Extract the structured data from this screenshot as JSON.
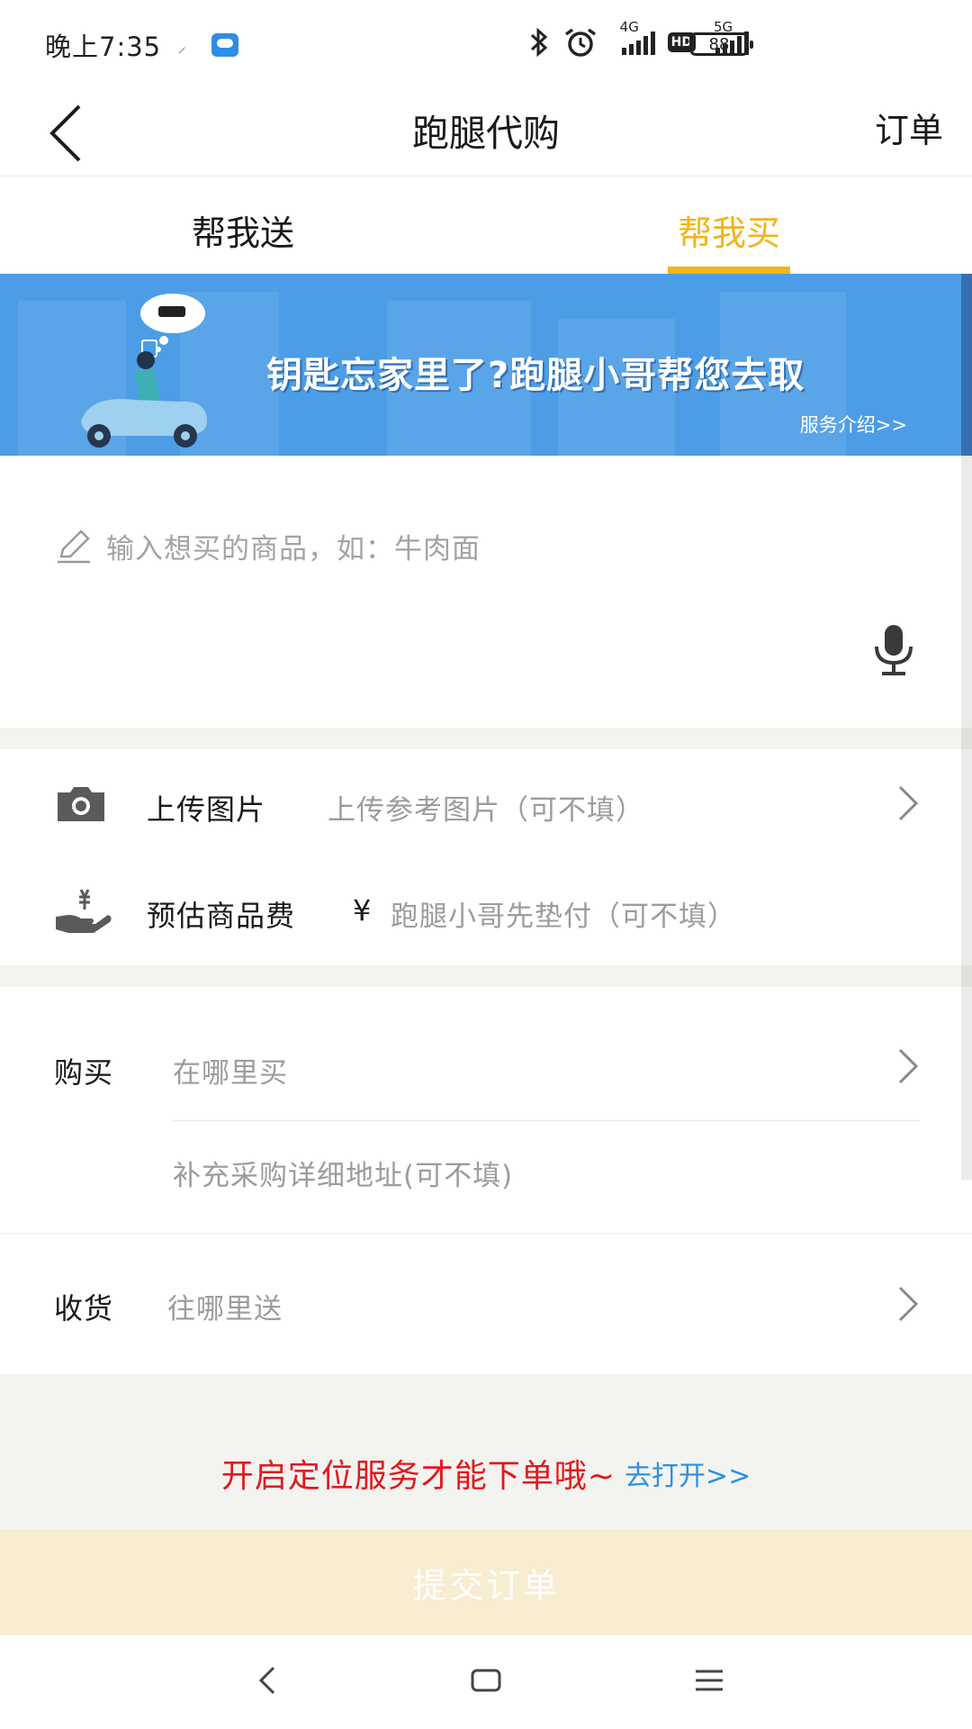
{
  "status_bar": {
    "time": "晚上7:35",
    "network_1": "4G",
    "network_2": "5G",
    "hd": "HD",
    "battery": "88"
  },
  "header": {
    "title": "跑腿代购",
    "orders_label": "订单"
  },
  "tabs": [
    {
      "label": "帮我送",
      "active": false
    },
    {
      "label": "帮我买",
      "active": true
    }
  ],
  "banner": {
    "headline": "钥匙忘家里了?跑腿小哥帮您去取",
    "intro_link": "服务介绍>>"
  },
  "product_input": {
    "placeholder": "输入想买的商品，如：牛肉面"
  },
  "upload_image": {
    "label": "上传图片",
    "hint": "上传参考图片（可不填）"
  },
  "estimated_fee": {
    "label": "预估商品费",
    "currency": "¥",
    "hint": "跑腿小哥先垫付（可不填）"
  },
  "purchase": {
    "label": "购买",
    "hint": "在哪里买",
    "detail_hint": "补充采购详细地址(可不填)"
  },
  "delivery": {
    "label": "收货",
    "hint": "往哪里送"
  },
  "location_notice": {
    "warning": "开启定位服务才能下单哦~",
    "open_link": "去打开>>"
  },
  "submit_label": "提交订单",
  "colors": {
    "accent": "#f0b51c",
    "banner_bg": "#4d9de6",
    "warning": "#e3181c",
    "link": "#2f8fe0",
    "submit_bg": "#f8ecd1"
  }
}
